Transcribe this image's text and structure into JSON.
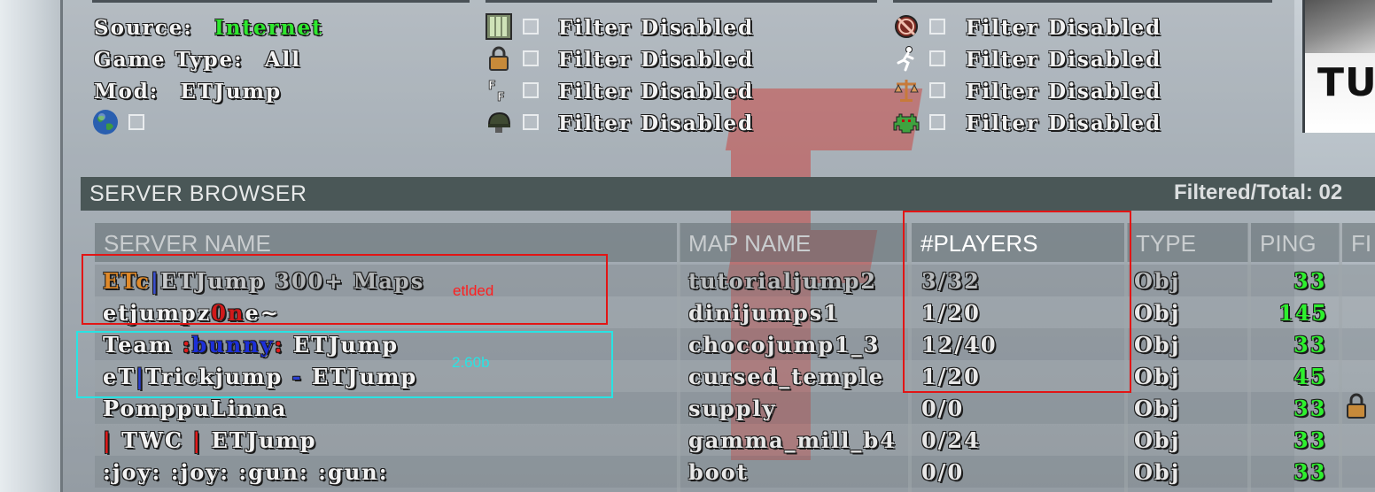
{
  "filters": {
    "source_label": "Source:",
    "source_value": "Internet",
    "gametype_label": "Game Type:",
    "gametype_value": "All",
    "mod_label": "Mod:",
    "mod_value": "ETJump",
    "disabled_text": "Filter Disabled",
    "icons_col1": [
      "server-rack-icon",
      "lock-icon",
      "friendly-fire-icon",
      "helmet-icon"
    ],
    "icons_col2": [
      "no-bots-icon",
      "runner-icon",
      "scales-icon",
      "invader-icon"
    ],
    "globe_icon": "globe-icon"
  },
  "server_browser": {
    "title": "SERVER BROWSER",
    "count_label": "Filtered/Total: 02"
  },
  "columns": {
    "server_name": "SERVER NAME",
    "map_name": "MAP NAME",
    "players": "#PLAYERS",
    "type": "TYPE",
    "ping": "PING",
    "filter_short": "FI"
  },
  "rows": [
    {
      "name_parts": [
        "ETc",
        "|",
        "ETJump",
        " 300+ Maps"
      ],
      "map": "tutorialjump2",
      "players": "3/32",
      "type": "Obj",
      "ping": "33",
      "dim": true
    },
    {
      "name_parts": [
        "etjumpz",
        "0n",
        "e",
        "~"
      ],
      "map": "dinijumps1",
      "players": "1/20",
      "type": "Obj",
      "ping": "145",
      "dim": false
    },
    {
      "name_parts": [
        "Team ",
        ":",
        "bunny",
        ":",
        " ETJump"
      ],
      "map": "chocojump1_3",
      "players": "12/40",
      "type": "Obj",
      "ping": "33",
      "dim": false
    },
    {
      "name_parts": [
        "eT",
        "|",
        "Trickjump",
        " - ",
        "ETJump"
      ],
      "map": "cursed_temple",
      "players": "1/20",
      "type": "Obj",
      "ping": "45",
      "dim": false
    },
    {
      "name_parts": [
        "PomppuLinna"
      ],
      "map": "supply",
      "players": "0/0",
      "type": "Obj",
      "ping": "33",
      "dim": false,
      "locked": true
    },
    {
      "name_parts": [
        "|",
        " TWC ",
        "|",
        " ETJump"
      ],
      "map": "gamma_mill_b4",
      "players": "0/24",
      "type": "Obj",
      "ping": "33",
      "dim": false
    },
    {
      "name_parts": [
        ":joy: :joy: :gun: :gun:"
      ],
      "map": "boot",
      "players": "0/0",
      "type": "Obj",
      "ping": "33",
      "dim": false
    }
  ],
  "annotations": {
    "red_note": "etlded",
    "cyan_note": "2.60b"
  },
  "thumbnail": {
    "text": "TUT"
  },
  "colors": {
    "accent_green": "#2ee82e",
    "annotation_red": "#e21515",
    "annotation_cyan": "#29e3e3",
    "header_bg": "#4a5757"
  }
}
